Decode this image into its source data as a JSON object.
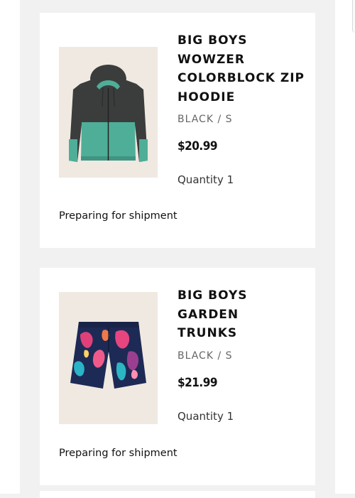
{
  "orders": [
    {
      "name": "BIG BOYS\nWOWZER\nCOLORBLOCK ZIP\nHOODIE",
      "variant": "BLACK / S",
      "price": "$20.99",
      "quantity": "Quantity 1",
      "status": "Preparing for shipment",
      "image_icon": "hoodie-product-image"
    },
    {
      "name": "BIG BOYS\nGARDEN\nTRUNKS",
      "variant": "BLACK / S",
      "price": "$21.99",
      "quantity": "Quantity 1",
      "status": "Preparing for shipment",
      "image_icon": "trunks-product-image"
    }
  ],
  "colors": {
    "page_background": "#f1f1f1",
    "card_background": "#ffffff",
    "image_background": "#efe9e1",
    "hoodie_body": "#3b3d3d",
    "hoodie_accent": "#4fae98",
    "trunks_base": "#1d2a55"
  }
}
